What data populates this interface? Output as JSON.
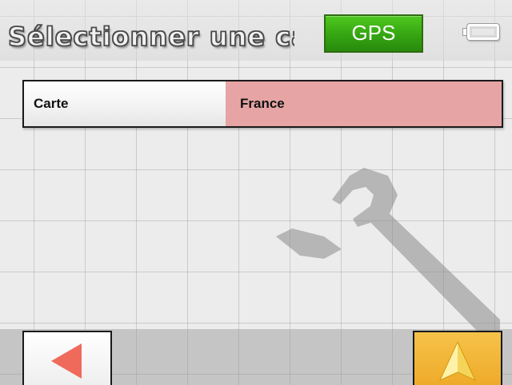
{
  "header": {
    "title": "Sélectionner une ca",
    "gps_label": "GPS",
    "battery_icon": "battery-icon"
  },
  "map_selection": {
    "label": "Carte",
    "value": "France"
  },
  "background": {
    "watermark_icon": "wrench-icon"
  },
  "bottom_bar": {
    "back_icon": "arrow-left-icon",
    "navigate_icon": "navigation-arrow-icon"
  },
  "colors": {
    "gps_green": "#35a412",
    "selection_red": "#e6a4a4",
    "back_arrow": "#f06a5c",
    "navigate_orange": "#eeaa28"
  }
}
